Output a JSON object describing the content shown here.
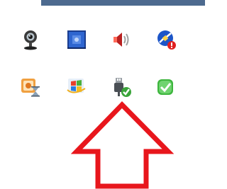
{
  "tray": {
    "row1": [
      {
        "icon": "webcam-icon"
      },
      {
        "icon": "network-adapter-icon"
      },
      {
        "icon": "speaker-volume-icon"
      },
      {
        "icon": "power-plug-warning-icon"
      }
    ],
    "row2": [
      {
        "icon": "hourglass-task-icon"
      },
      {
        "icon": "windows-logo-icon"
      },
      {
        "icon": "usb-safely-remove-icon"
      },
      {
        "icon": "green-check-icon"
      }
    ]
  },
  "annotation": {
    "arrow_color": "#e8161c",
    "arrow_target": "usb-safely-remove-icon"
  },
  "colors": {
    "top_bar": "#4d6a8f",
    "check_green": "#3aa43a",
    "warning_red": "#e02020"
  }
}
